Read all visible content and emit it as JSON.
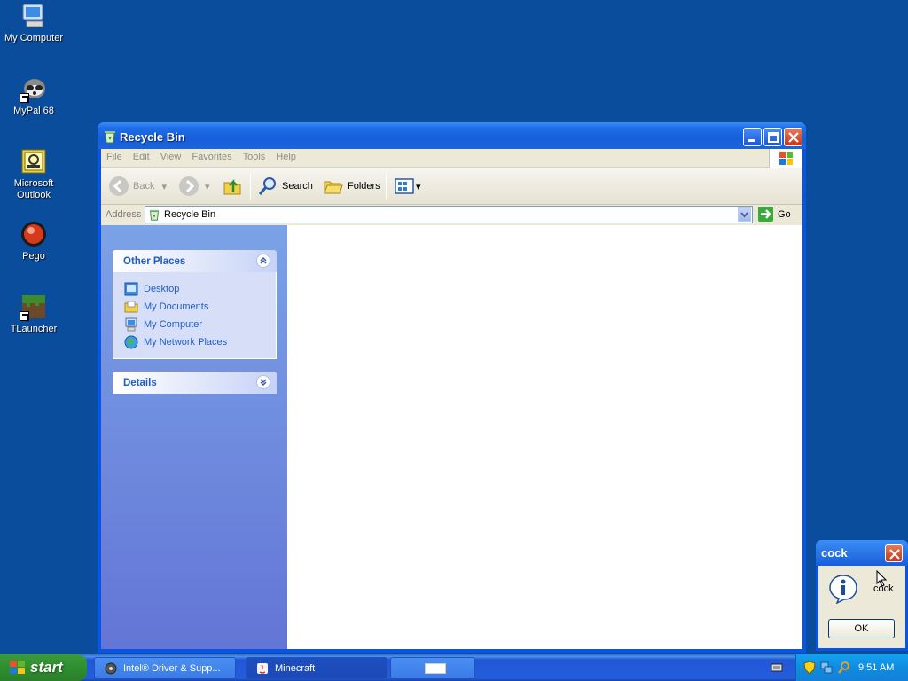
{
  "desktop": {
    "icons": [
      {
        "label": "My Computer"
      },
      {
        "label": "MyPal 68"
      },
      {
        "label": "Microsoft Outlook"
      },
      {
        "label": "Pego"
      },
      {
        "label": "TLauncher"
      }
    ]
  },
  "window": {
    "title": "Recycle Bin",
    "menu": [
      "File",
      "Edit",
      "View",
      "Favorites",
      "Tools",
      "Help"
    ],
    "toolbar": {
      "back": "Back",
      "search": "Search",
      "folders": "Folders"
    },
    "address": {
      "label": "Address",
      "value": "Recycle Bin",
      "go": "Go"
    },
    "task_pane": {
      "other_places": {
        "title": "Other Places",
        "links": [
          "Desktop",
          "My Documents",
          "My Computer",
          "My Network Places"
        ]
      },
      "details": {
        "title": "Details"
      }
    }
  },
  "message_box": {
    "title": "cock",
    "text": "cock",
    "ok": "OK"
  },
  "taskbar": {
    "start": "start",
    "tasks": [
      {
        "label": "Intel® Driver & Supp..."
      },
      {
        "label": "Minecraft"
      }
    ],
    "clock": "9:51 AM"
  }
}
